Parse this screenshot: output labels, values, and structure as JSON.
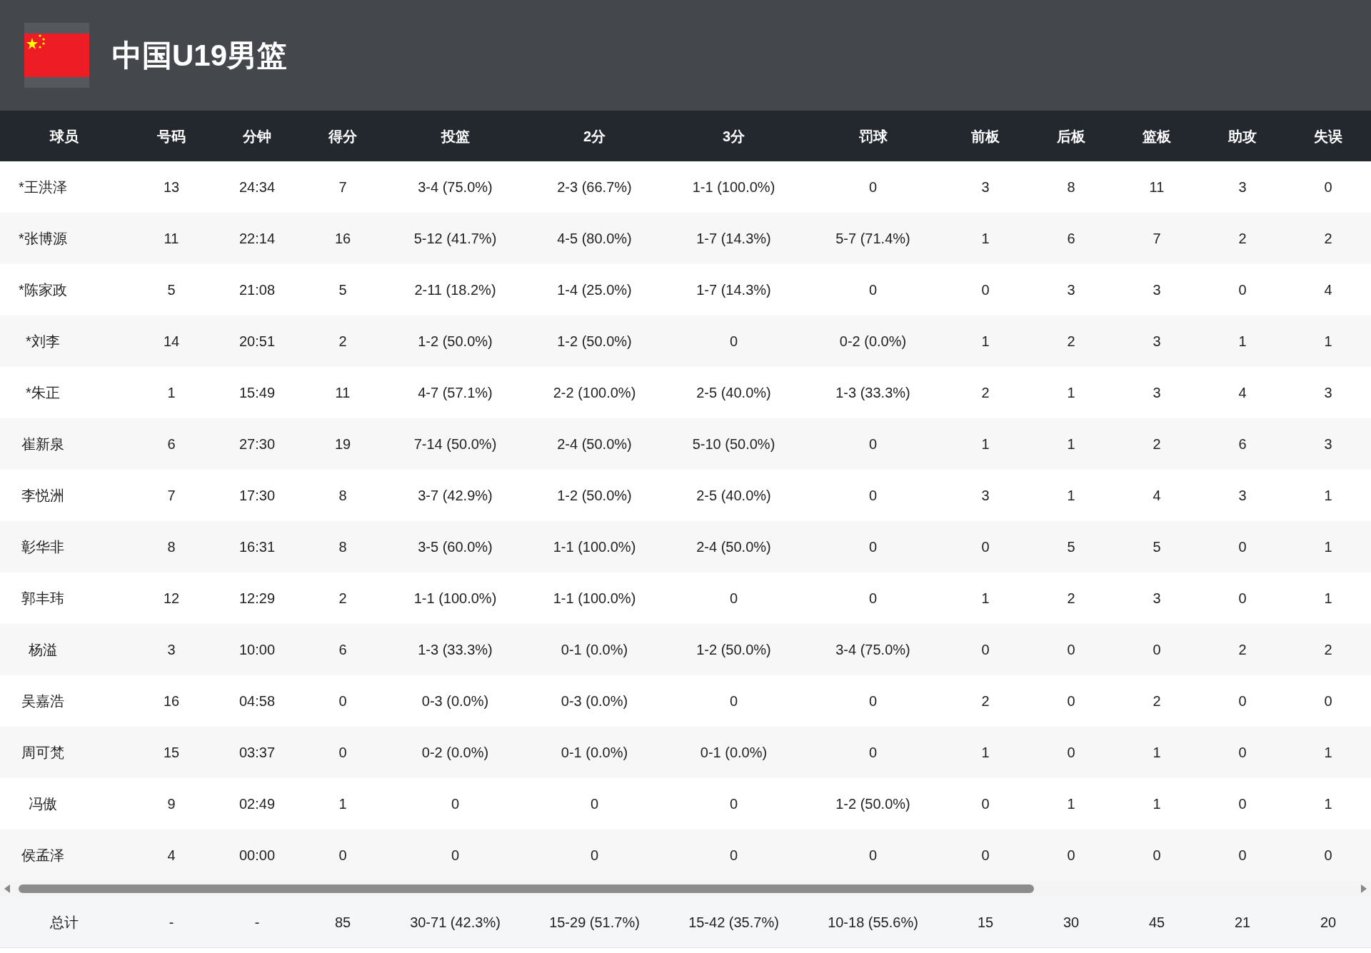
{
  "team": {
    "name": "中国U19男篮"
  },
  "table": {
    "columns": [
      "球员",
      "号码",
      "分钟",
      "得分",
      "投篮",
      "2分",
      "3分",
      "罚球",
      "前板",
      "后板",
      "篮板",
      "助攻",
      "失误"
    ],
    "rows": [
      [
        "*王洪泽",
        "13",
        "24:34",
        "7",
        "3-4 (75.0%)",
        "2-3 (66.7%)",
        "1-1 (100.0%)",
        "0",
        "3",
        "8",
        "11",
        "3",
        "0"
      ],
      [
        "*张博源",
        "11",
        "22:14",
        "16",
        "5-12 (41.7%)",
        "4-5 (80.0%)",
        "1-7 (14.3%)",
        "5-7 (71.4%)",
        "1",
        "6",
        "7",
        "2",
        "2"
      ],
      [
        "*陈家政",
        "5",
        "21:08",
        "5",
        "2-11 (18.2%)",
        "1-4 (25.0%)",
        "1-7 (14.3%)",
        "0",
        "0",
        "3",
        "3",
        "0",
        "4"
      ],
      [
        "*刘李",
        "14",
        "20:51",
        "2",
        "1-2 (50.0%)",
        "1-2 (50.0%)",
        "0",
        "0-2 (0.0%)",
        "1",
        "2",
        "3",
        "1",
        "1"
      ],
      [
        "*朱正",
        "1",
        "15:49",
        "11",
        "4-7 (57.1%)",
        "2-2 (100.0%)",
        "2-5 (40.0%)",
        "1-3 (33.3%)",
        "2",
        "1",
        "3",
        "4",
        "3"
      ],
      [
        "崔新泉",
        "6",
        "27:30",
        "19",
        "7-14 (50.0%)",
        "2-4 (50.0%)",
        "5-10 (50.0%)",
        "0",
        "1",
        "1",
        "2",
        "6",
        "3"
      ],
      [
        "李悦洲",
        "7",
        "17:30",
        "8",
        "3-7 (42.9%)",
        "1-2 (50.0%)",
        "2-5 (40.0%)",
        "0",
        "3",
        "1",
        "4",
        "3",
        "1"
      ],
      [
        "彰华非",
        "8",
        "16:31",
        "8",
        "3-5 (60.0%)",
        "1-1 (100.0%)",
        "2-4 (50.0%)",
        "0",
        "0",
        "5",
        "5",
        "0",
        "1"
      ],
      [
        "郭丰玮",
        "12",
        "12:29",
        "2",
        "1-1 (100.0%)",
        "1-1 (100.0%)",
        "0",
        "0",
        "1",
        "2",
        "3",
        "0",
        "1"
      ],
      [
        "杨溢",
        "3",
        "10:00",
        "6",
        "1-3 (33.3%)",
        "0-1 (0.0%)",
        "1-2 (50.0%)",
        "3-4 (75.0%)",
        "0",
        "0",
        "0",
        "2",
        "2"
      ],
      [
        "吴嘉浩",
        "16",
        "04:58",
        "0",
        "0-3 (0.0%)",
        "0-3 (0.0%)",
        "0",
        "0",
        "2",
        "0",
        "2",
        "0",
        "0"
      ],
      [
        "周可梵",
        "15",
        "03:37",
        "0",
        "0-2 (0.0%)",
        "0-1 (0.0%)",
        "0-1 (0.0%)",
        "0",
        "1",
        "0",
        "1",
        "0",
        "1"
      ],
      [
        "冯傲",
        "9",
        "02:49",
        "1",
        "0",
        "0",
        "0",
        "1-2 (50.0%)",
        "0",
        "1",
        "1",
        "0",
        "1"
      ],
      [
        "侯孟泽",
        "4",
        "00:00",
        "0",
        "0",
        "0",
        "0",
        "0",
        "0",
        "0",
        "0",
        "0",
        "0"
      ]
    ],
    "totals": [
      "总计",
      "-",
      "-",
      "85",
      "30-71 (42.3%)",
      "15-29 (51.7%)",
      "15-42 (35.7%)",
      "10-18 (55.6%)",
      "15",
      "30",
      "45",
      "21",
      "20"
    ]
  }
}
